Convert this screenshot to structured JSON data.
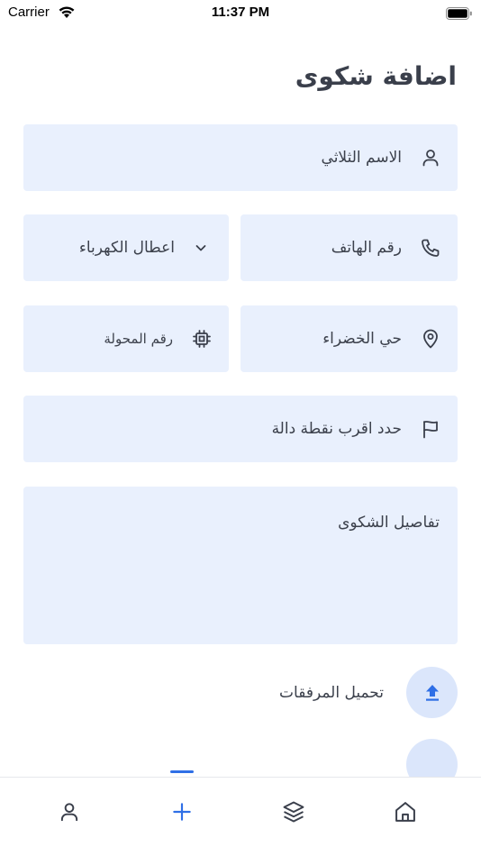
{
  "status_bar": {
    "carrier": "Carrier",
    "time": "11:37 PM"
  },
  "page": {
    "title": "اضافة شكوى"
  },
  "form": {
    "full_name": {
      "label": "الاسم الثلاثي",
      "icon": "user-icon"
    },
    "phone": {
      "label": "رقم الهاتف",
      "icon": "phone-icon"
    },
    "complaint_type": {
      "label": "اعطال الكهرباء",
      "icon": "chevron-down-icon"
    },
    "area": {
      "label": "حي الخضراء",
      "icon": "location-pin-icon"
    },
    "transformer_number": {
      "label": "رقم المحولة",
      "icon": "chip-icon"
    },
    "landmark": {
      "label": "حدد اقرب نقطة دالة",
      "icon": "flag-icon"
    },
    "details": {
      "label": "تفاصيل الشكوى"
    },
    "attachments": {
      "label": "تحميل المرفقات",
      "icon": "upload-icon"
    }
  },
  "tab_bar": {
    "tabs": [
      {
        "name": "profile",
        "icon": "user-icon",
        "active": false
      },
      {
        "name": "add",
        "icon": "plus-icon",
        "active": true
      },
      {
        "name": "layers",
        "icon": "layers-icon",
        "active": false
      },
      {
        "name": "home",
        "icon": "home-icon",
        "active": false
      }
    ]
  },
  "colors": {
    "field_bg": "#e9f0fd",
    "accent": "#2f6fe6",
    "upload_bg": "#dbe6fb",
    "text": "#3c414c"
  }
}
